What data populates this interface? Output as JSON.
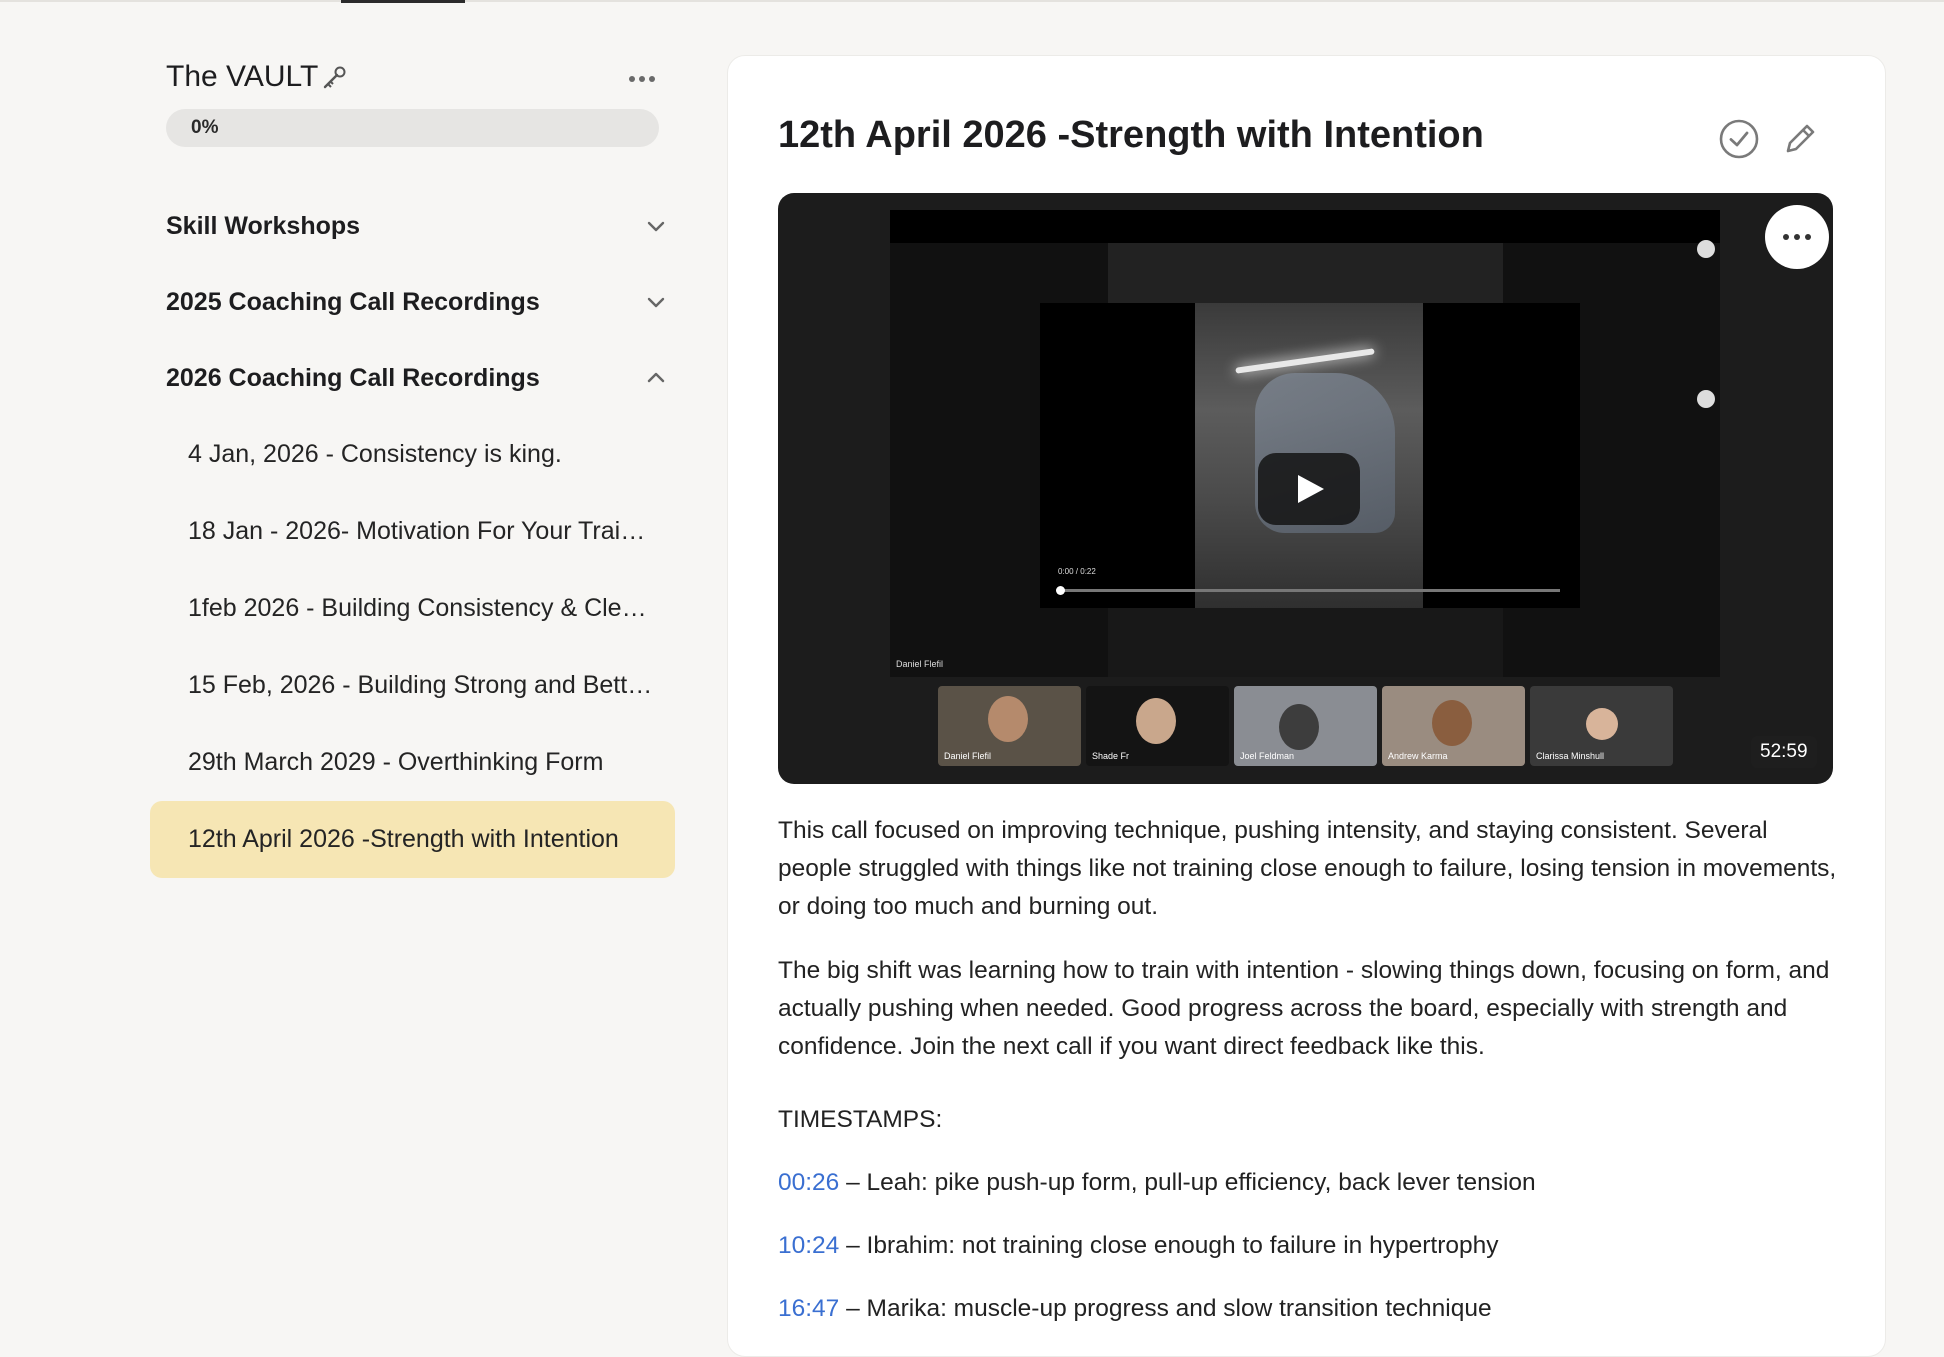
{
  "sidebar": {
    "course_title": "The VAULT",
    "progress": {
      "label": "0%",
      "value": 0
    },
    "sections": [
      {
        "label": "Skill Workshops",
        "expanded": false
      },
      {
        "label": "2025 Coaching Call Recordings",
        "expanded": false
      },
      {
        "label": "2026 Coaching Call Recordings",
        "expanded": true
      }
    ],
    "lessons": [
      {
        "label": "4 Jan, 2026 - Consistency is king."
      },
      {
        "label": "18 Jan - 2026- Motivation For Your Train…"
      },
      {
        "label": "1feb 2026 - Building Consistency & Clea…"
      },
      {
        "label": "15 Feb, 2026 - Building Strong and Bette…"
      },
      {
        "label": "29th March 2029 - Overthinking Form"
      },
      {
        "label": "12th April 2026 -Strength with Intention",
        "active": true
      }
    ]
  },
  "main": {
    "title": "12th April 2026 -Strength with Intention",
    "video": {
      "duration": "52:59",
      "player_time": "0:00 / 0:22",
      "speaker_label": "Daniel Flefil",
      "participants": [
        "Daniel Flefil",
        "Shade Fr",
        "Joel Feldman",
        "Andrew Karma",
        "Clarissa Minshull"
      ]
    },
    "description": [
      "This call focused on improving technique, pushing intensity, and staying consistent. Several people struggled with things like not training close enough to failure, losing tension in movements, or doing too much and burning out.",
      "The big shift was learning how to train with intention - slowing things down, focusing on form, and actually pushing when needed. Good progress across the board, especially with strength and confidence. Join the next call if you want direct feedback like this."
    ],
    "timestamps_heading": "TIMESTAMPS:",
    "timestamps": [
      {
        "time": "00:26",
        "text": " – Leah: pike push-up form, pull-up efficiency, back lever tension"
      },
      {
        "time": "10:24",
        "text": " – Ibrahim: not training close enough to failure in hypertrophy"
      },
      {
        "time": "16:47",
        "text": " – Marika: muscle-up progress and slow transition technique"
      }
    ]
  },
  "colors": {
    "accent_link": "#3a6fd1",
    "active_lesson_bg": "#f6e6b4",
    "card_bg": "#ffffff",
    "page_bg": "#f7f6f4"
  },
  "icons": [
    "key-icon",
    "more-dots-icon",
    "chevron-down-icon",
    "chevron-up-icon",
    "check-circle-icon",
    "pencil-icon",
    "play-icon"
  ]
}
